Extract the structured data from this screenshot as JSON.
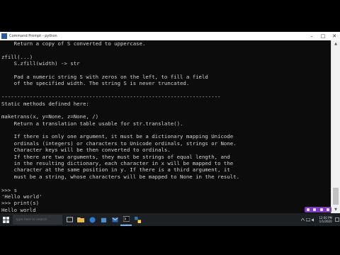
{
  "window": {
    "title": "Command Prompt - python"
  },
  "console": {
    "lines": [
      "    Return a copy of S converted to uppercase.",
      "",
      "zfill(...)",
      "    S.zfill(width) -> str",
      "",
      "    Pad a numeric string S with zeros on the left, to fill a field",
      "    of the specified width. The string S is never truncated.",
      "",
      "----------------------------------------------------------------------",
      "Static methods defined here:",
      "",
      "maketrans(x, y=None, z=None, /)",
      "    Return a translation table usable for str.translate().",
      "",
      "    If there is only one argument, it must be a dictionary mapping Unicode",
      "    ordinals (integers) or characters to Unicode ordinals, strings or None.",
      "    Character keys will be then converted to ordinals.",
      "    If there are two arguments, they must be strings of equal length, and",
      "    in the resulting dictionary, each character in x will be mapped to the",
      "    character at the same position in y. If there is a third argument, it",
      "    must be a string, whose characters will be mapped to None in the result.",
      "",
      ">>> s",
      "'Hello world'",
      ">>> print(s)",
      "Hello world",
      ">>>"
    ]
  },
  "taskbar": {
    "search_placeholder": "Type here to search",
    "clock_time": "12:00 PM",
    "clock_date": "1/1/2020"
  },
  "colors": {
    "console_bg": "#0c0c0c",
    "console_fg": "#d4d4d4",
    "taskbar_bg": "#1b2024",
    "accent": "#7b3fb5"
  },
  "icons": {
    "window": "cmd-icon",
    "minimize": "minimize-icon",
    "maximize": "maximize-icon",
    "close": "close-icon",
    "start": "windows-start-icon",
    "search": "search-icon",
    "task_view": "task-view-icon",
    "explorer": "folder-icon",
    "browser": "browser-icon",
    "terminal": "terminal-icon"
  }
}
